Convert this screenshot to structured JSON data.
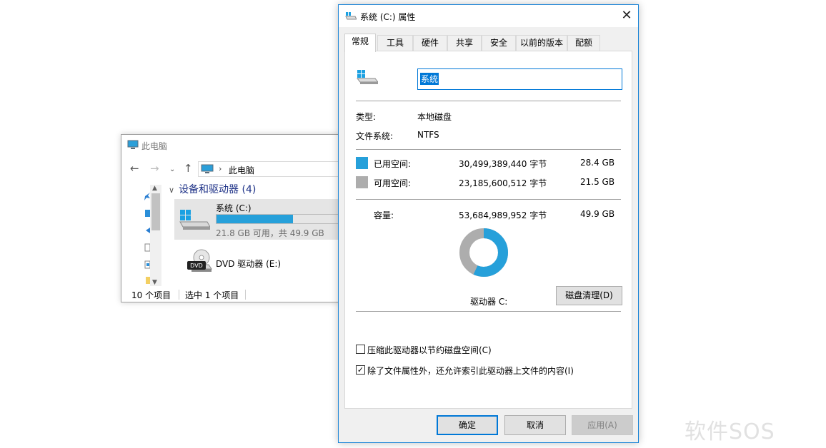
{
  "explorer": {
    "title": "此电脑",
    "address": "此电脑",
    "group_header": "设备和驱动器 (4)",
    "drives": [
      {
        "name": "系统 (C:)",
        "used_fraction": 0.57,
        "info": "21.8 GB 可用，共 49.9 GB"
      },
      {
        "name": "DVD 驱动器 (E:)"
      }
    ],
    "status": {
      "item_count": "10 个项目",
      "selected": "选中 1 个项目"
    }
  },
  "dialog": {
    "title": "系统 (C:) 属性",
    "tabs": [
      "常规",
      "工具",
      "硬件",
      "共享",
      "安全",
      "以前的版本",
      "配额"
    ],
    "active_tab": "常规",
    "volume_name": "系统",
    "type_label": "类型:",
    "type_value": "本地磁盘",
    "fs_label": "文件系统:",
    "fs_value": "NTFS",
    "used": {
      "label": "已用空间:",
      "bytes": "30,499,389,440 字节",
      "gb": "28.4 GB",
      "color": "#26a0da"
    },
    "free": {
      "label": "可用空间:",
      "bytes": "23,185,600,512 字节",
      "gb": "21.5 GB",
      "color": "#adadad"
    },
    "capacity": {
      "label": "容量:",
      "bytes": "53,684,989,952 字节",
      "gb": "49.9 GB"
    },
    "drive_label": "驱动器 C:",
    "cleanup_button": "磁盘清理(D)",
    "compress_label": "压缩此驱动器以节约磁盘空间(C)",
    "compress_checked": false,
    "index_label": "除了文件属性外，还允许索引此驱动器上文件的内容(I)",
    "index_checked": true,
    "ok_button": "确定",
    "cancel_button": "取消",
    "apply_button": "应用(A)"
  },
  "watermark": "软件SOS"
}
